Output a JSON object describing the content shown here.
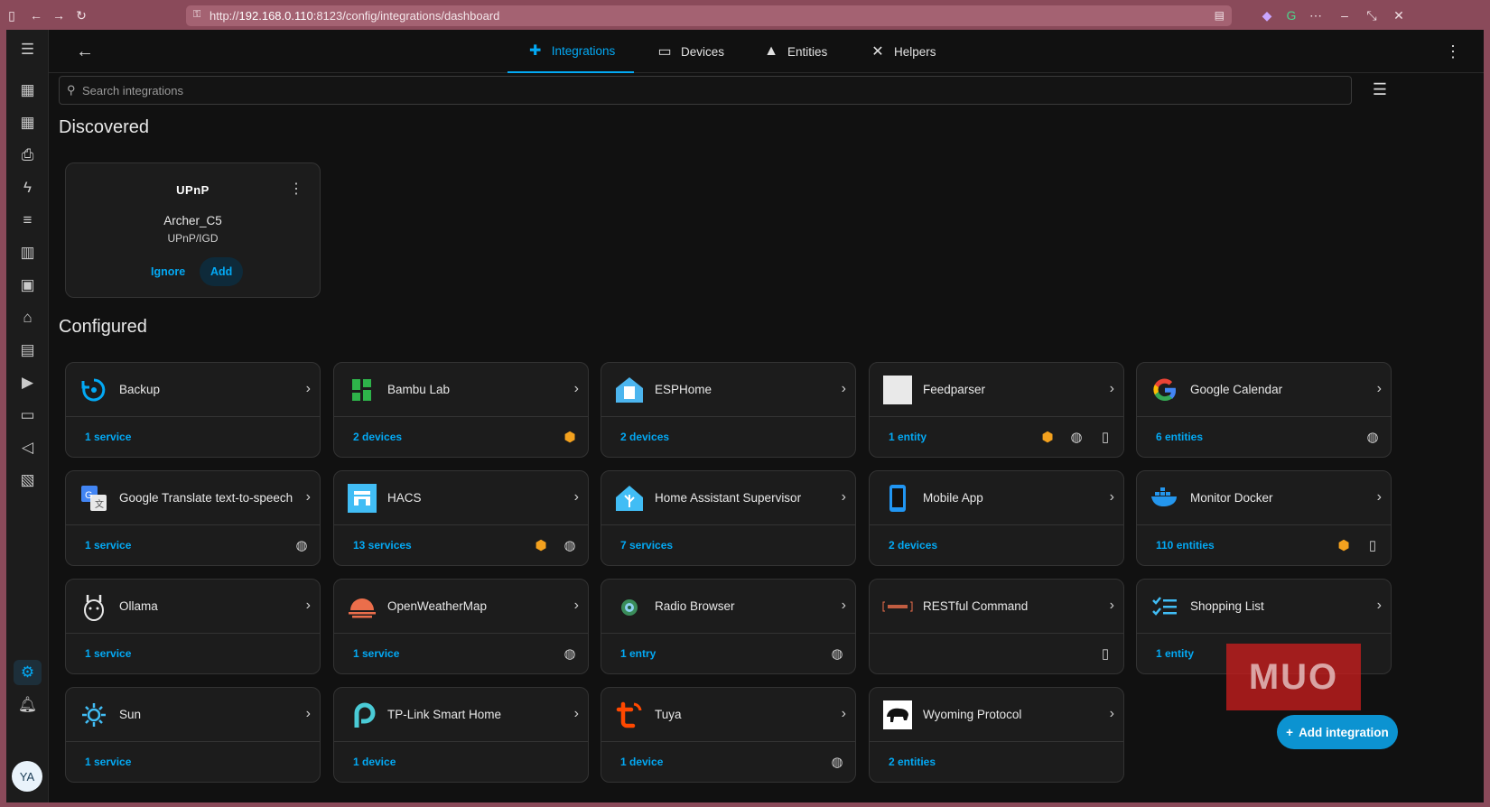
{
  "browser": {
    "url_prefix": "http://",
    "url_host": "192.168.0.110",
    "url_rest": ":8123/config/integrations/dashboard"
  },
  "tabs": [
    {
      "label": "Integrations",
      "icon": "puzzle-icon"
    },
    {
      "label": "Devices",
      "icon": "devices-icon"
    },
    {
      "label": "Entities",
      "icon": "shapes-icon"
    },
    {
      "label": "Helpers",
      "icon": "tools-icon"
    }
  ],
  "search": {
    "placeholder": "Search integrations"
  },
  "discovered": {
    "title": "Discovered",
    "card": {
      "logo_text": "UPnP",
      "name": "Archer_C5",
      "subtitle": "UPnP/IGD",
      "ignore_label": "Ignore",
      "add_label": "Add"
    }
  },
  "configured": {
    "title": "Configured",
    "cards": [
      {
        "name": "Backup",
        "count": "1 service"
      },
      {
        "name": "Bambu Lab",
        "count": "2 devices"
      },
      {
        "name": "ESPHome",
        "count": "2 devices"
      },
      {
        "name": "Feedparser",
        "count": "1 entity"
      },
      {
        "name": "Google Calendar",
        "count": "6 entities"
      },
      {
        "name": "Google Translate text-to-speech",
        "count": "1 service"
      },
      {
        "name": "HACS",
        "count": "13 services"
      },
      {
        "name": "Home Assistant Supervisor",
        "count": "7 services"
      },
      {
        "name": "Mobile App",
        "count": "2 devices"
      },
      {
        "name": "Monitor Docker",
        "count": "110 entities"
      },
      {
        "name": "Ollama",
        "count": "1 service"
      },
      {
        "name": "OpenWeatherMap",
        "count": "1 service"
      },
      {
        "name": "Radio Browser",
        "count": "1 entry"
      },
      {
        "name": "RESTful Command",
        "count": ""
      },
      {
        "name": "Shopping List",
        "count": "1 entity"
      },
      {
        "name": "Sun",
        "count": "1 service"
      },
      {
        "name": "TP-Link Smart Home",
        "count": "1 device"
      },
      {
        "name": "Tuya",
        "count": "1 device"
      },
      {
        "name": "Wyoming Protocol",
        "count": "2 entities"
      }
    ]
  },
  "fab": {
    "label": "Add integration"
  },
  "user": {
    "initials": "YA"
  },
  "watermark": "MUO",
  "colors": {
    "accent": "#03a9f4",
    "custom_badge": "#f3a11e",
    "background": "#111111",
    "card": "#1c1c1c"
  }
}
